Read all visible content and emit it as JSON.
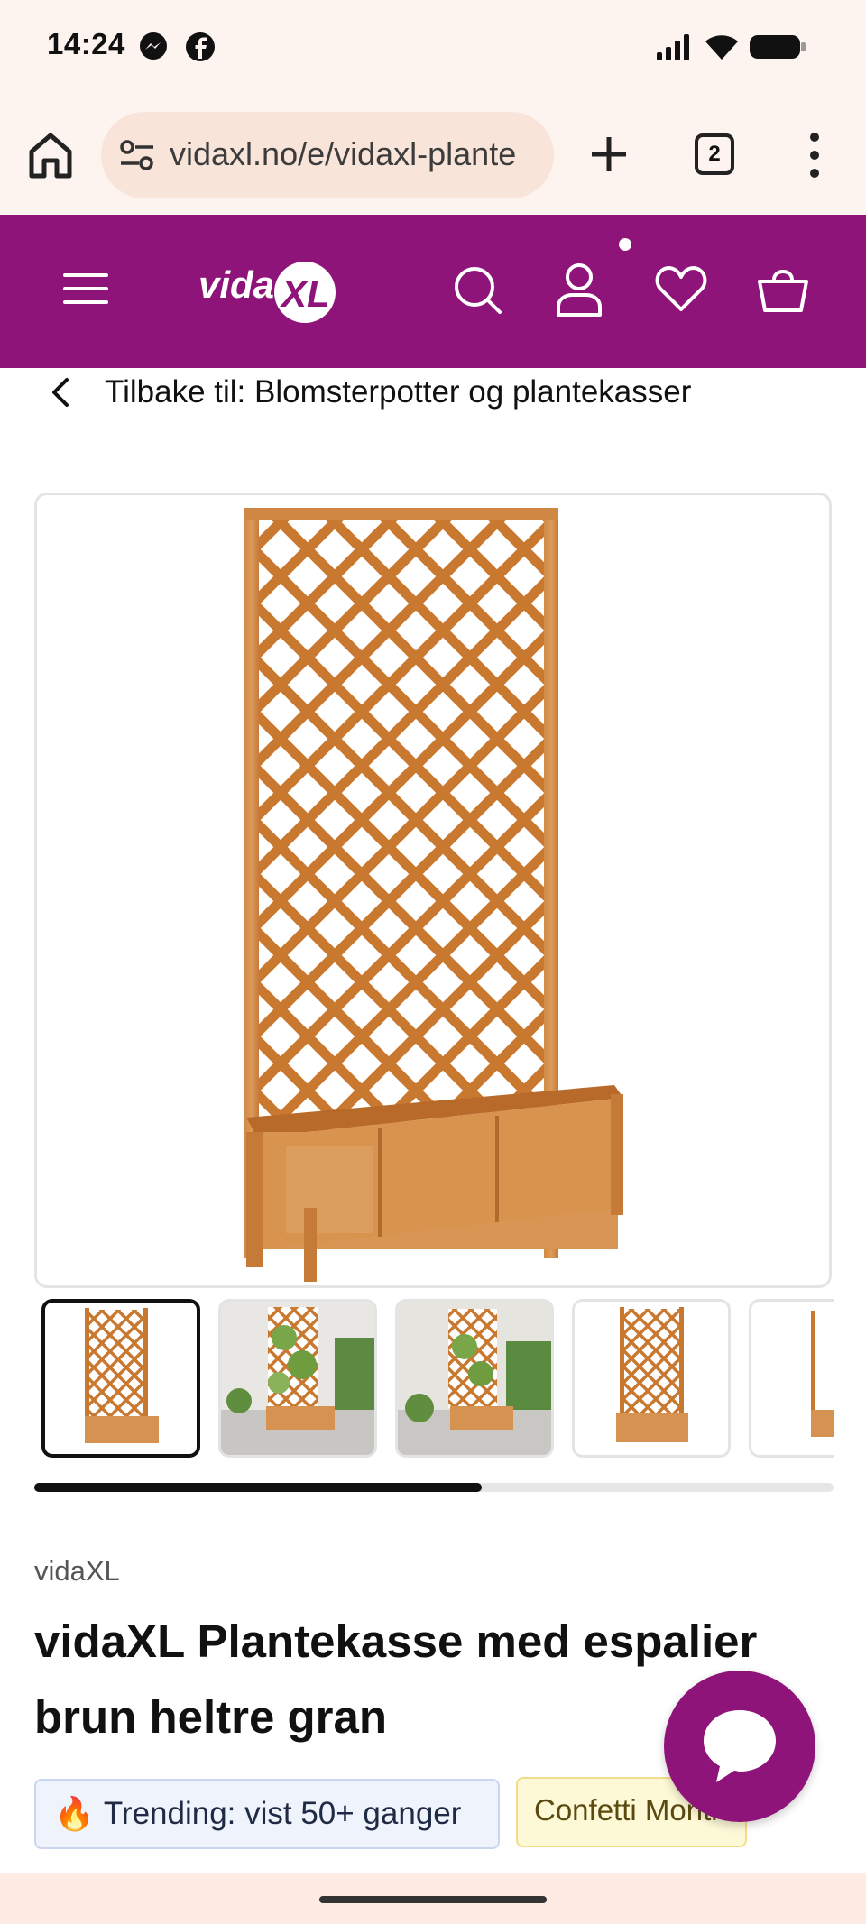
{
  "status_bar": {
    "time": "14:24",
    "notification_icons": [
      "messenger-icon",
      "facebook-icon"
    ],
    "system_icons": [
      "signal-icon",
      "wifi-icon",
      "battery-icon"
    ]
  },
  "browser": {
    "url": "vidaxl.no/e/vidaxl-plante",
    "tab_count": "2"
  },
  "site_header": {
    "brand_color": "#8f1479",
    "logo_text": "vidaXL",
    "icons": [
      "menu-icon",
      "search-icon",
      "account-icon",
      "wishlist-icon",
      "cart-icon"
    ]
  },
  "breadcrumb": {
    "label": "Tilbake til: Blomsterpotter og plantekasser"
  },
  "gallery": {
    "main_image": "trellis-planter-image",
    "thumbnails": [
      {
        "name": "thumbnail-1",
        "active": true
      },
      {
        "name": "thumbnail-2",
        "active": false
      },
      {
        "name": "thumbnail-3",
        "active": false
      },
      {
        "name": "thumbnail-4",
        "active": false
      },
      {
        "name": "thumbnail-5",
        "active": false
      }
    ],
    "scroll_progress": 0.56
  },
  "product": {
    "brand": "vidaXL",
    "title": "vidaXL Plantekasse med espalier brun heltre gran",
    "badges": {
      "trending_icon": "🔥",
      "trending": "Trending: vist 50+ ganger",
      "promo": "Confetti Monti"
    }
  },
  "chat": {
    "icon": "chat-bubble-icon"
  }
}
